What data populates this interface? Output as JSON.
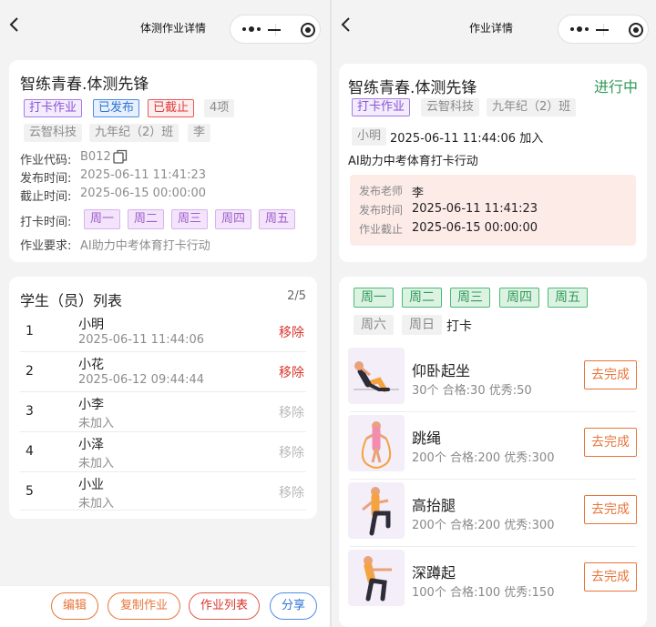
{
  "left": {
    "nav_title": "体测作业详情",
    "info": {
      "title": "智练青春.体测先锋",
      "tags": [
        "打卡作业",
        "已发布",
        "已截止",
        "4项"
      ],
      "org_tags": [
        "云智科技",
        "九年纪（2）班",
        "李"
      ],
      "code_label": "作业代码:",
      "code_value": "B012",
      "publish_label": "发布时间:",
      "publish_value": "2025-06-11 11:41:23",
      "deadline_label": "截止时间:",
      "deadline_value": "2025-06-15 00:00:00",
      "checkin_label": "打卡时间:",
      "checkin_days": [
        "周一",
        "周二",
        "周三",
        "周四",
        "周五"
      ],
      "req_label": "作业要求:",
      "req_value": "AI助力中考体育打卡行动"
    },
    "students": {
      "title": "学生（员）列表",
      "count": "2/5",
      "rows": [
        {
          "no": "1",
          "name": "小明",
          "sub": "2025-06-11 11:44:06",
          "action": "移除"
        },
        {
          "no": "2",
          "name": "小花",
          "sub": "2025-06-12 09:44:44",
          "action": "移除"
        },
        {
          "no": "3",
          "name": "小李",
          "sub": "未加入",
          "action": "移除"
        },
        {
          "no": "4",
          "name": "小泽",
          "sub": "未加入",
          "action": "移除"
        },
        {
          "no": "5",
          "name": "小业",
          "sub": "未加入",
          "action": "移除"
        }
      ]
    },
    "buttons": {
      "edit": "编辑",
      "copy": "复制作业",
      "list": "作业列表",
      "share": "分享"
    }
  },
  "right": {
    "nav_title": "作业详情",
    "info": {
      "title": "智练青春.体测先锋",
      "status": "进行中",
      "tags": [
        "打卡作业",
        "云智科技",
        "九年纪（2）班"
      ],
      "student_tag": "小明",
      "join_time": "2025-06-11 11:44:06 加入",
      "desc": "AI助力中考体育打卡行动",
      "teacher_label": "发布老师",
      "teacher_value": "李",
      "publish_label": "发布时间",
      "publish_value": "2025-06-11 11:41:23",
      "deadline_label": "作业截止",
      "deadline_value": "2025-06-15 00:00:00"
    },
    "days_active": [
      "周一",
      "周二",
      "周三",
      "周四",
      "周五"
    ],
    "days_inactive": [
      "周六",
      "周日"
    ],
    "checkin_word": "打卡",
    "exercises": [
      {
        "name": "仰卧起坐",
        "detail": "30个 合格:30 优秀:50",
        "action": "去完成",
        "icon": "situp-figure-icon"
      },
      {
        "name": "跳绳",
        "detail": "200个 合格:200 优秀:300",
        "action": "去完成",
        "icon": "jump-rope-figure-icon"
      },
      {
        "name": "高抬腿",
        "detail": "200个 合格:200 优秀:300",
        "action": "去完成",
        "icon": "high-knee-figure-icon"
      },
      {
        "name": "深蹲起",
        "detail": "100个 合格:100 优秀:150",
        "action": "去完成",
        "icon": "squat-figure-icon"
      }
    ]
  }
}
